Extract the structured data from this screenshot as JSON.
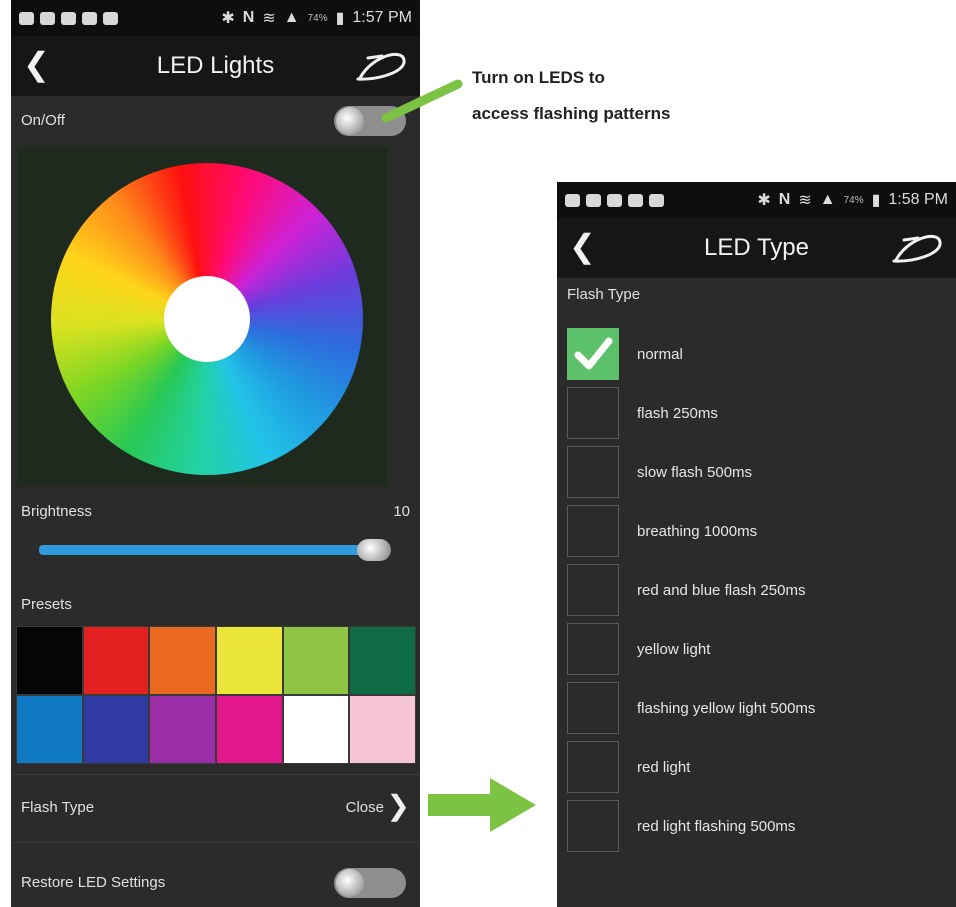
{
  "screen1": {
    "status_time": "1:57 PM",
    "status_battery": "74%",
    "title": "LED Lights",
    "back_icon": "chevron-left-icon",
    "onoff_label": "On/Off",
    "brightness_label": "Brightness",
    "brightness_value": "10",
    "presets_label": "Presets",
    "presets": [
      "#050505",
      "#e32121",
      "#ea6a21",
      "#ebe53b",
      "#8fc444",
      "#0f6b45",
      "#0f79c4",
      "#2f3aa2",
      "#9b2fa7",
      "#e0188c",
      "#ffffff",
      "#f6c6d6"
    ],
    "flash_type_label": "Flash Type",
    "flash_type_value": "Close",
    "restore_label": "Restore LED Settings"
  },
  "annotation": {
    "line1": "Turn on LEDS to",
    "line2": "access flashing patterns",
    "color": "#7cc243"
  },
  "screen2": {
    "status_time": "1:58 PM",
    "status_battery": "74%",
    "title": "LED Type",
    "section_label": "Flash Type",
    "options": [
      {
        "label": "normal",
        "checked": true
      },
      {
        "label": "flash 250ms",
        "checked": false
      },
      {
        "label": "slow flash 500ms",
        "checked": false
      },
      {
        "label": "breathing 1000ms",
        "checked": false
      },
      {
        "label": "red and blue flash 250ms",
        "checked": false
      },
      {
        "label": "yellow light",
        "checked": false
      },
      {
        "label": "flashing yellow light 500ms",
        "checked": false
      },
      {
        "label": "red light",
        "checked": false
      },
      {
        "label": "red light flashing 500ms",
        "checked": false
      }
    ]
  },
  "colors": {
    "accent_green": "#7cc243",
    "slider_blue": "#2f9bdc",
    "check_green": "#5cc16a"
  }
}
